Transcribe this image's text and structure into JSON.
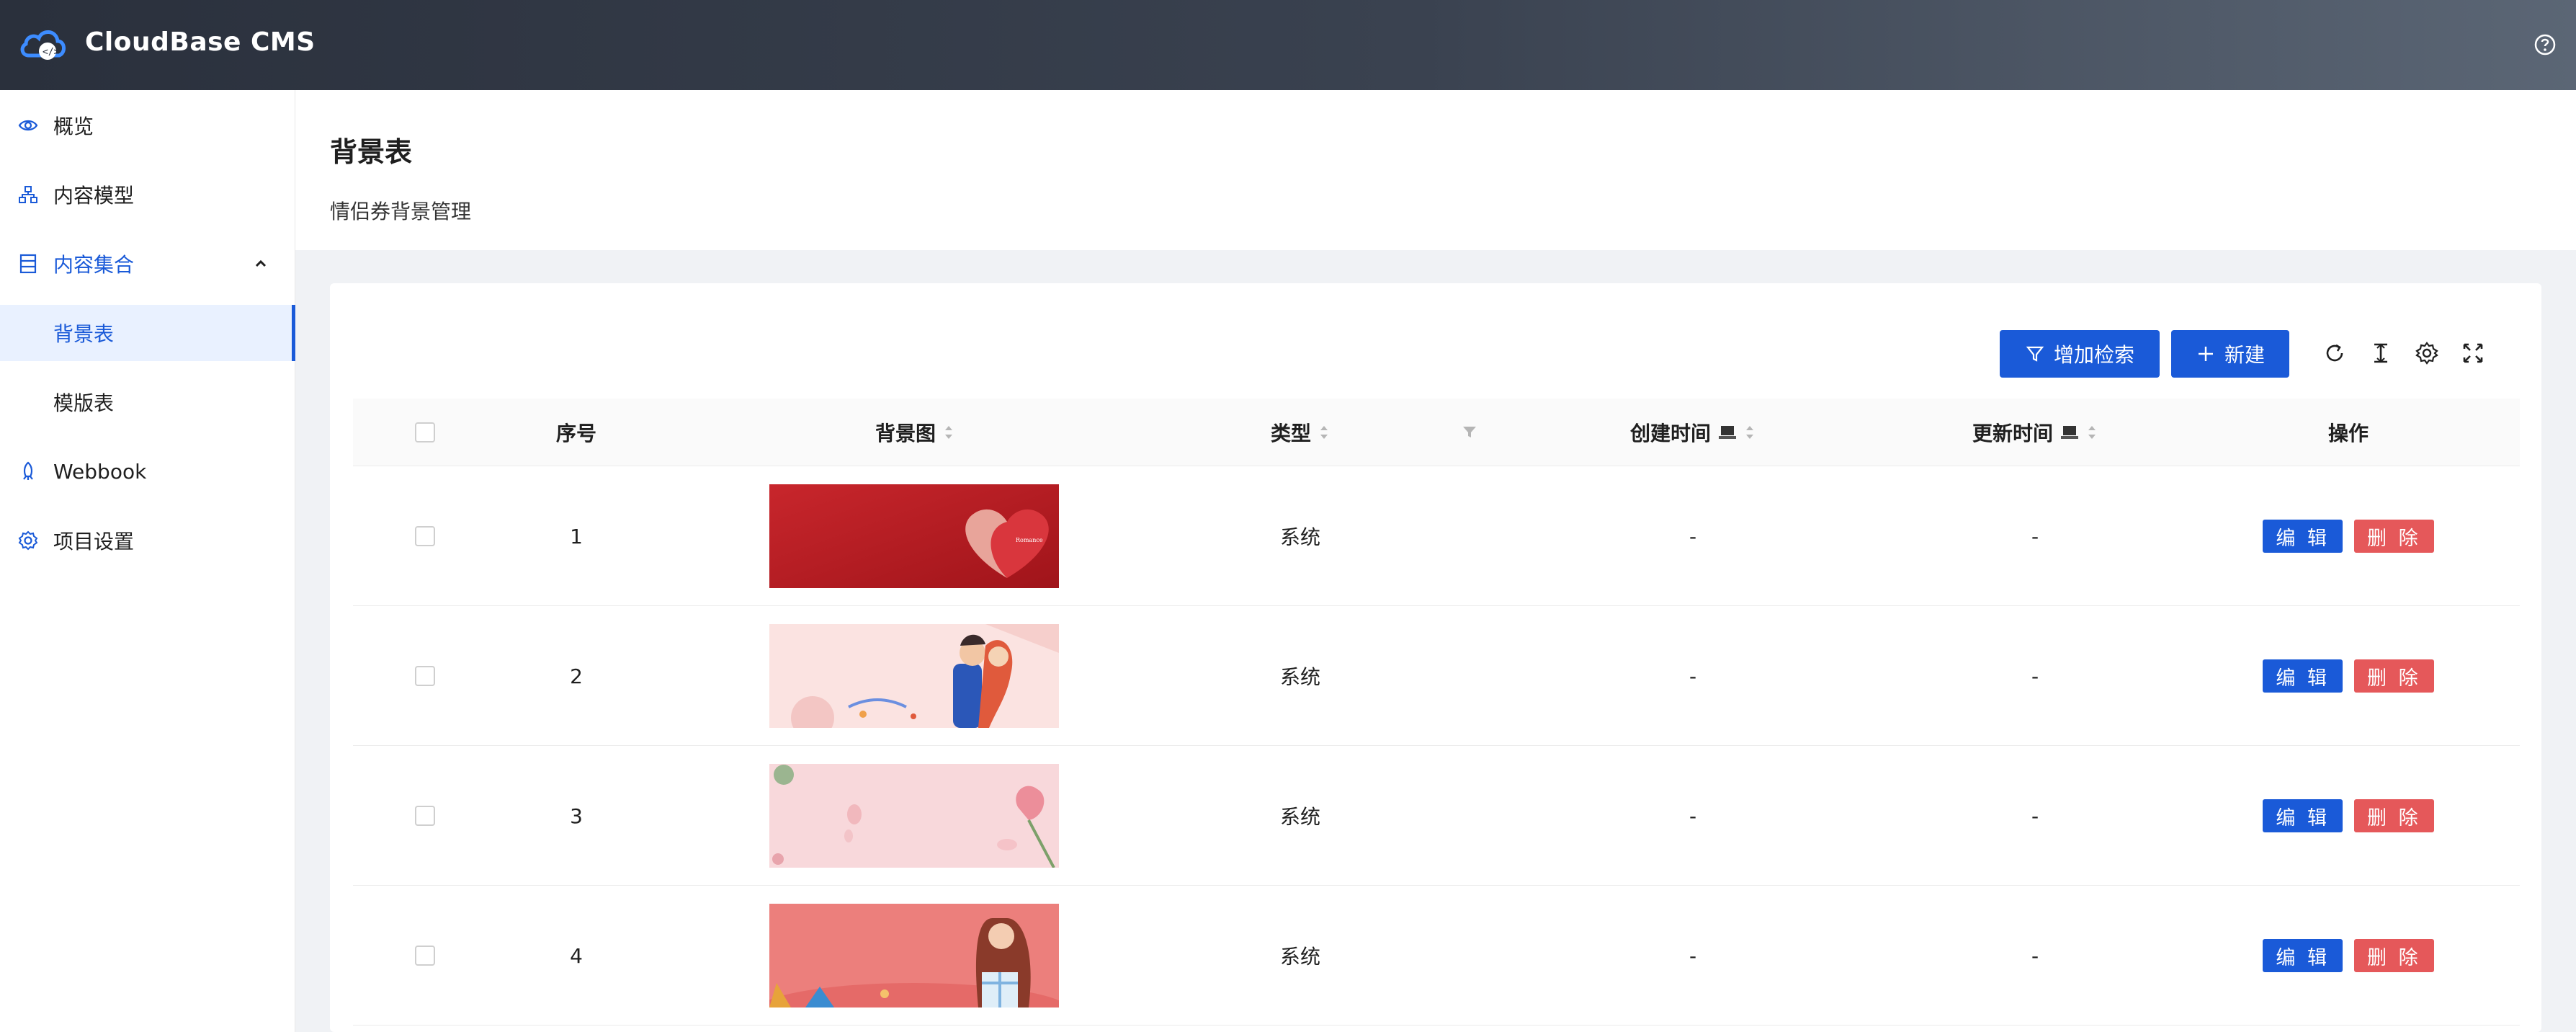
{
  "app": {
    "title": "CloudBase CMS"
  },
  "sidebar": {
    "items": [
      {
        "label": "概览",
        "icon": "eye-icon"
      },
      {
        "label": "内容模型",
        "icon": "model-icon"
      },
      {
        "label": "内容集合",
        "icon": "collection-icon",
        "expanded": true
      },
      {
        "label": "背景表",
        "active": true
      },
      {
        "label": "模版表"
      },
      {
        "label": "Webbook",
        "icon": "rocket-icon"
      },
      {
        "label": "项目设置",
        "icon": "gear-icon"
      }
    ]
  },
  "page": {
    "title": "背景表",
    "description": "情侣券背景管理"
  },
  "toolbar": {
    "filter_label": "增加检索",
    "new_label": "新建",
    "icons": [
      "reload-icon",
      "density-icon",
      "settings-icon",
      "fullscreen-icon"
    ]
  },
  "table": {
    "columns": [
      "序号",
      "背景图",
      "类型",
      "创建时间",
      "更新时间",
      "操作"
    ],
    "rows": [
      {
        "index": "1",
        "image": "red-heart-background",
        "type": "系统",
        "created": "-",
        "updated": "-"
      },
      {
        "index": "2",
        "image": "couple-pink-background",
        "type": "系统",
        "created": "-",
        "updated": "-"
      },
      {
        "index": "3",
        "image": "pink-rose-background",
        "type": "系统",
        "created": "-",
        "updated": "-"
      },
      {
        "index": "4",
        "image": "girl-gift-background",
        "type": "系统",
        "created": "-",
        "updated": "-"
      }
    ],
    "edit_label": "编 辑",
    "delete_label": "删 除"
  },
  "colors": {
    "primary": "#1a5ad8",
    "danger": "#e5585a",
    "header_bg": "#2a303c"
  }
}
